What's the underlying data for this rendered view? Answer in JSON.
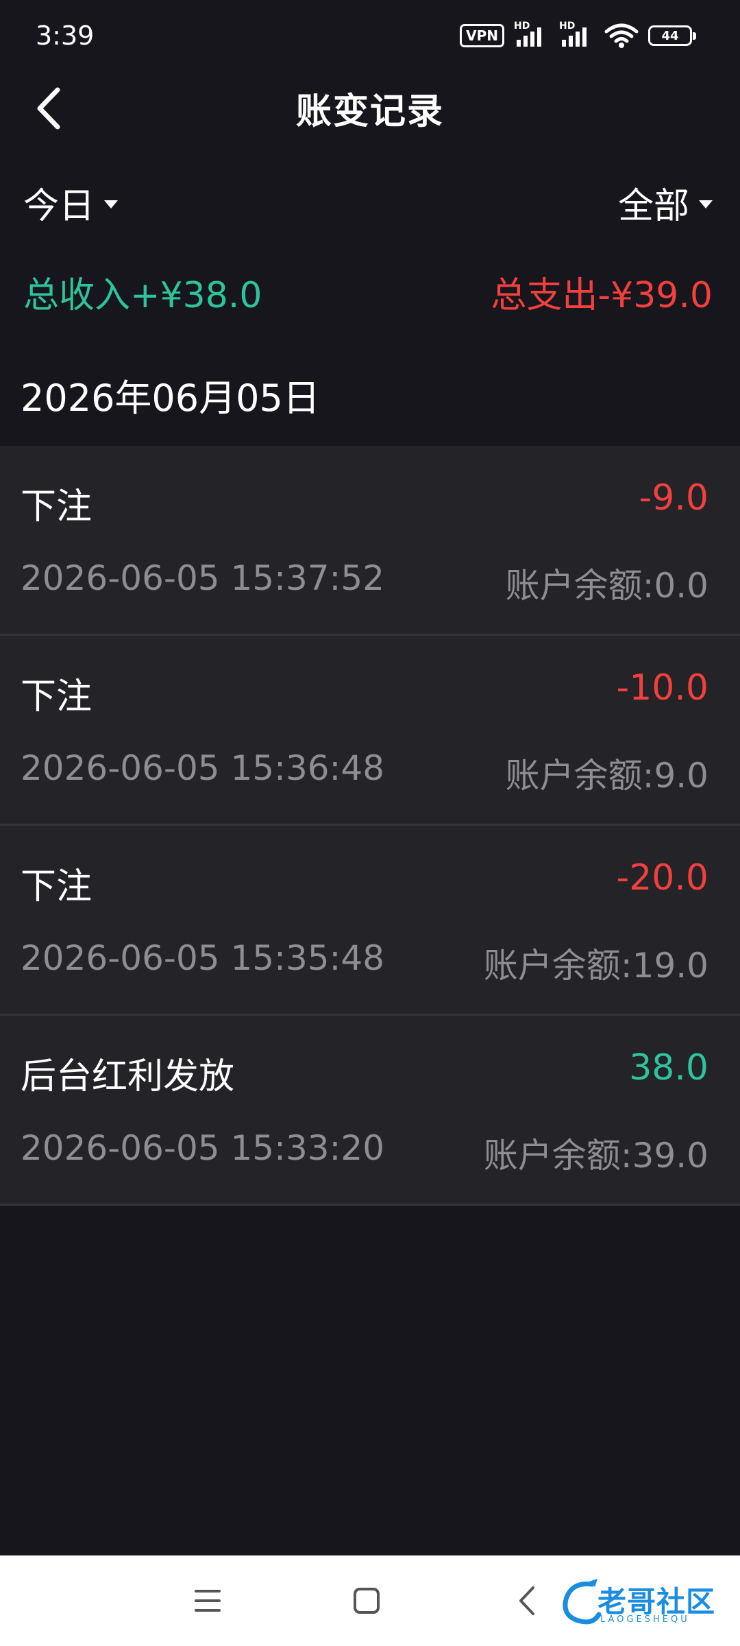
{
  "status_bar": {
    "time": "3:39",
    "vpn_label": "VPN",
    "hd_label_1": "HD",
    "hd_label_2": "HD",
    "battery_level": "44"
  },
  "header": {
    "title": "账变记录",
    "back_icon": "chevron-left-icon"
  },
  "filters": {
    "date_filter": "今日",
    "type_filter": "全部"
  },
  "totals": {
    "income": "总收入+¥38.0",
    "expense": "总支出-¥39.0"
  },
  "date_group": "2026年06月05日",
  "records": [
    {
      "title": "下注",
      "amount": "-9.0",
      "time": "2026-06-05 15:37:52",
      "balance": "账户余额:0.0"
    },
    {
      "title": "下注",
      "amount": "-10.0",
      "time": "2026-06-05 15:36:48",
      "balance": "账户余额:9.0"
    },
    {
      "title": "下注",
      "amount": "-20.0",
      "time": "2026-06-05 15:35:48",
      "balance": "账户余额:19.0"
    },
    {
      "title": "后台红利发放",
      "amount": "38.0",
      "time": "2026-06-05 15:33:20",
      "balance": "账户余额:39.0"
    }
  ],
  "colors": {
    "background": "#17161c",
    "card": "#232328",
    "income_green": "#2ec49b",
    "expense_red": "#f2403e",
    "muted_text": "#8d8d92"
  },
  "watermark": {
    "text": "老哥社区",
    "subtext": "LAOGESHEQU"
  }
}
